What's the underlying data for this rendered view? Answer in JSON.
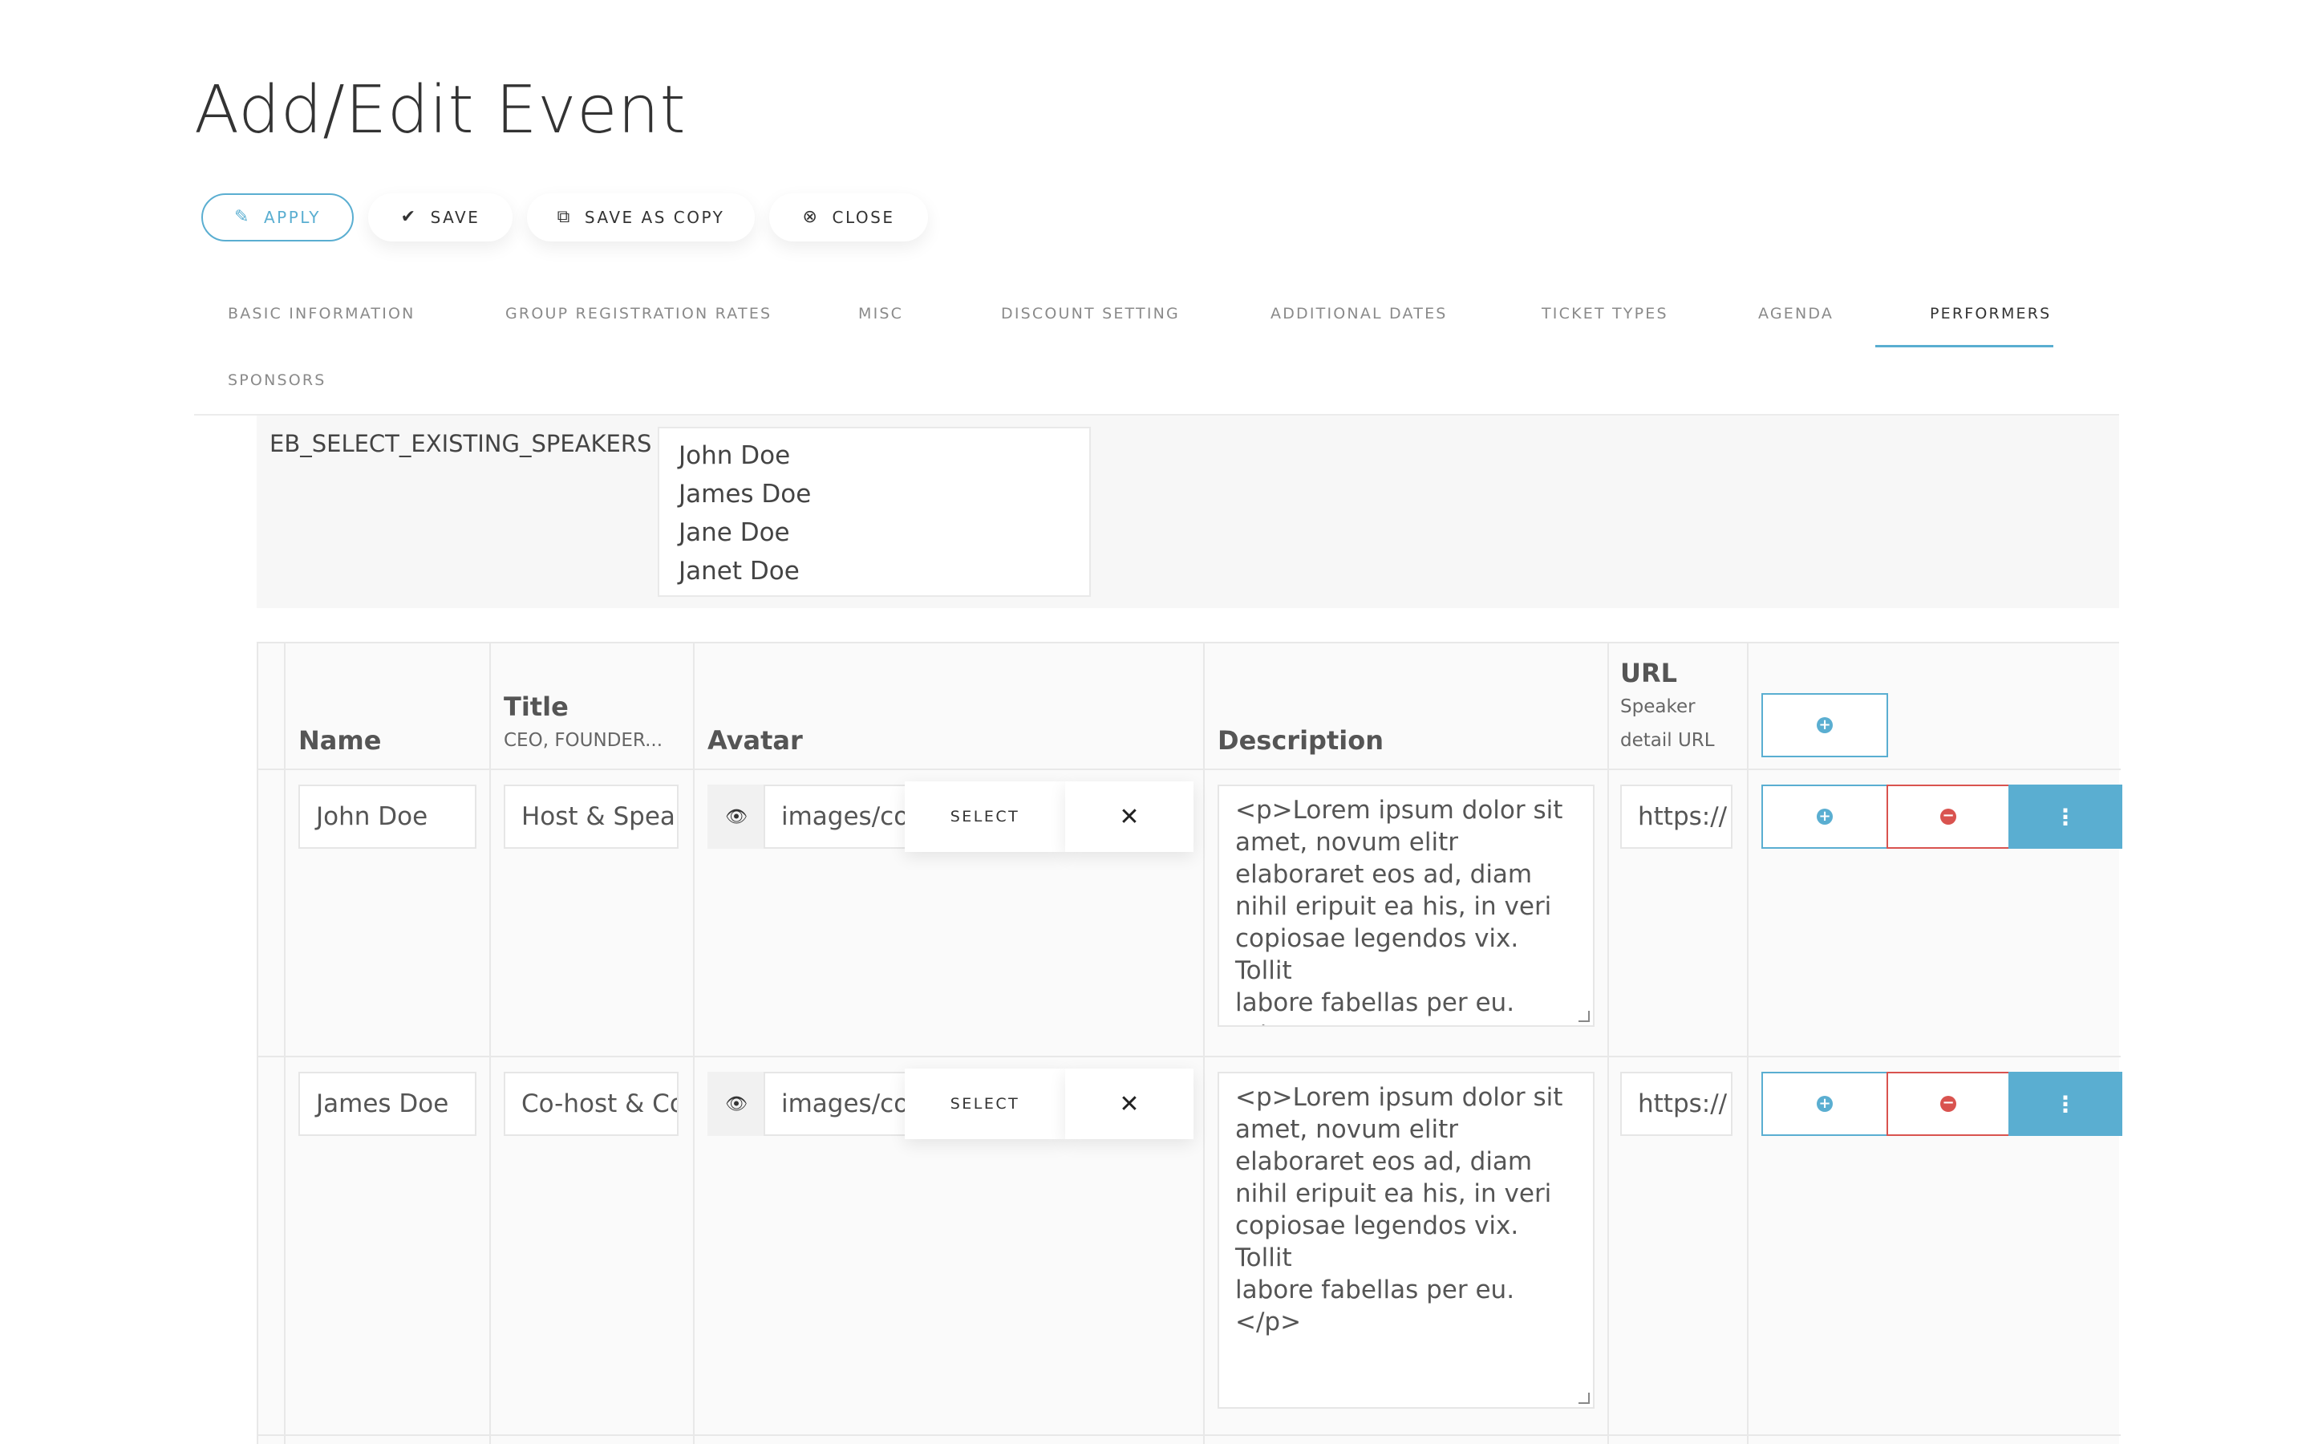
{
  "page": {
    "title": "Add/Edit Event"
  },
  "toolbar": {
    "apply": "APPLY",
    "save": "SAVE",
    "save_as_copy": "SAVE AS COPY",
    "close": "CLOSE"
  },
  "tabs": [
    {
      "label": "BASIC INFORMATION",
      "active": false
    },
    {
      "label": "GROUP REGISTRATION RATES",
      "active": false
    },
    {
      "label": "MISC",
      "active": false
    },
    {
      "label": "DISCOUNT SETTING",
      "active": false
    },
    {
      "label": "ADDITIONAL DATES",
      "active": false
    },
    {
      "label": "TICKET TYPES",
      "active": false
    },
    {
      "label": "AGENDA",
      "active": false
    },
    {
      "label": "PERFORMERS",
      "active": true
    },
    {
      "label": "SPONSORS",
      "active": false
    }
  ],
  "speakers_select": {
    "label": "EB_SELECT_EXISTING_SPEAKERS",
    "options": [
      "John Doe",
      "James Doe",
      "Jane Doe",
      "Janet Doe"
    ]
  },
  "table": {
    "headers": {
      "name": "Name",
      "title": "Title",
      "title_hint": "CEO, FOUNDER...",
      "avatar": "Avatar",
      "description": "Description",
      "url": "URL",
      "url_hint_1": "Speaker",
      "url_hint_2": "detail URL"
    },
    "select_label": "SELECT",
    "rows": [
      {
        "name": "John Doe",
        "title": "Host & Speaker",
        "avatar": "images/com_eventbooking/",
        "description": "<p>Lorem ipsum dolor sit\namet, novum elitr\nelaboraret eos ad, diam\nnihil eripuit ea his, in veri\ncopiosae legendos vix. Tollit\nlabore fabellas per eu.</p>",
        "url": "https://"
      },
      {
        "name": "James Doe",
        "title": "Co-host & Co-speaker",
        "avatar": "images/com_eventbooking/",
        "description": "<p>Lorem ipsum dolor sit\namet, novum elitr\nelaboraret eos ad, diam\nnihil eripuit ea his, in veri\ncopiosae legendos vix. Tollit\nlabore fabellas per eu.</p>",
        "url": "https://"
      }
    ]
  },
  "colors": {
    "accent": "#5aaed1",
    "danger": "#d9534f"
  }
}
